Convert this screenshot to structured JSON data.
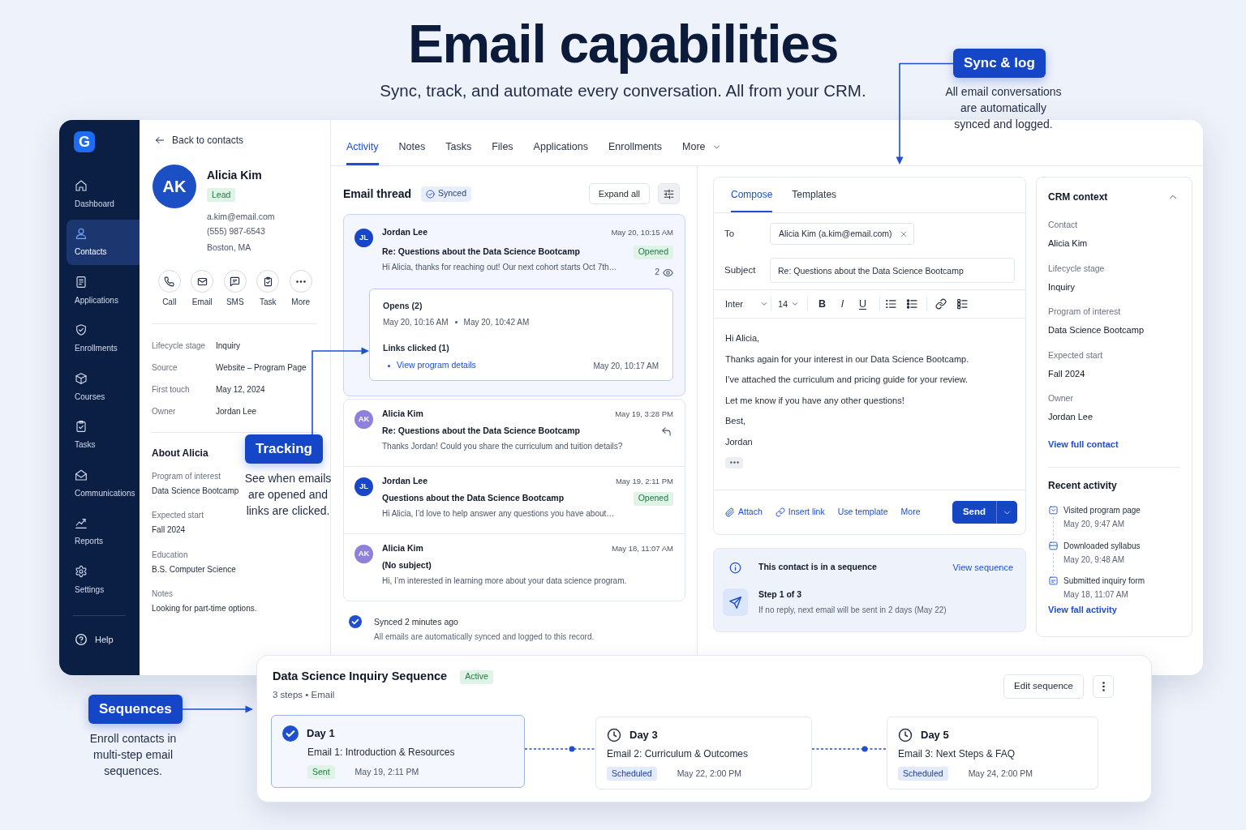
{
  "hero": {
    "title": "Email capabilities",
    "subtitle": "Sync, track, and automate every conversation. All from your CRM."
  },
  "sidebar": {
    "logo": "G",
    "items": [
      {
        "label": "Dashboard",
        "selected": false
      },
      {
        "label": "Contacts",
        "selected": true
      },
      {
        "label": "Applications",
        "selected": false
      },
      {
        "label": "Enrollments",
        "selected": false
      },
      {
        "label": "Courses",
        "selected": false
      },
      {
        "label": "Tasks",
        "selected": false
      },
      {
        "label": "Communications",
        "selected": false
      },
      {
        "label": "Reports",
        "selected": false
      },
      {
        "label": "Settings",
        "selected": false
      }
    ],
    "help": "Help"
  },
  "contact": {
    "back": "Back to contacts",
    "initials": "AK",
    "name": "Alicia Kim",
    "badge": "Lead",
    "email": "a.kim@email.com",
    "phone": "(555) 987-6543",
    "location": "Boston, MA",
    "actions": [
      "Call",
      "Email",
      "SMS",
      "Task",
      "More"
    ],
    "fields": [
      {
        "label": "Lifecycle stage",
        "value": "Inquiry"
      },
      {
        "label": "Source",
        "value": "Website – Program Page"
      },
      {
        "label": "First touch",
        "value": "May 12, 2024"
      },
      {
        "label": "Owner",
        "value": "Jordan Lee"
      }
    ],
    "about_title": "About Alicia",
    "about": [
      {
        "label": "Program of interest",
        "value": "Data Science Bootcamp"
      },
      {
        "label": "Expected start",
        "value": "Fall 2024"
      },
      {
        "label": "Education",
        "value": "B.S. Computer Science"
      },
      {
        "label": "Notes",
        "value": "Looking for part-time options."
      }
    ]
  },
  "tabs": [
    {
      "label": "Activity",
      "selected": true,
      "kind": "tab"
    },
    {
      "label": "Notes",
      "selected": false,
      "kind": "tab"
    },
    {
      "label": "Tasks",
      "selected": false,
      "kind": "tab"
    },
    {
      "label": "Files",
      "selected": false,
      "kind": "tab"
    },
    {
      "label": "Applications",
      "selected": false,
      "kind": "tab"
    },
    {
      "label": "Enrollments",
      "selected": false,
      "kind": "tab"
    },
    {
      "label": "More",
      "selected": false,
      "kind": "menu"
    }
  ],
  "thread": {
    "title": "Email thread",
    "status": "Synced",
    "expand": "Expand all",
    "messages": [
      {
        "initials": "JL",
        "sender": "Jordan Lee",
        "date": "May 20, 10:15 AM",
        "subject": "Re: Questions about the Data Science Bootcamp",
        "preview": "Hi Alicia, thanks for reaching out! Our next cohort starts Oct 7th…",
        "color": "#1747c8",
        "badge": "Opened",
        "opens": "2",
        "replied": false,
        "expanded": true,
        "tracking": {
          "opens_title": "Opens (2)",
          "opens": [
            "May 20, 10:16 AM",
            "May 20, 10:42 AM"
          ],
          "links_title": "Links clicked (1)",
          "links": [
            {
              "label": "View program details",
              "time": "May 20, 10:17 AM"
            }
          ]
        }
      },
      {
        "initials": "AK",
        "sender": "Alicia Kim",
        "date": "May 19, 3:28 PM",
        "subject": "Re: Questions about the Data Science Bootcamp",
        "preview": "Thanks Jordan! Could you share the curriculum and tuition details?",
        "color": "#8f80dc",
        "replied": true,
        "expanded": false
      },
      {
        "initials": "JL",
        "sender": "Jordan Lee",
        "date": "May 19, 2:11 PM",
        "subject": "Questions about the Data Science Bootcamp",
        "preview": "Hi Alicia, I’d love to help answer any questions you have about…",
        "color": "#1747c8",
        "badge": "Opened",
        "replied": false,
        "expanded": false
      },
      {
        "initials": "AK",
        "sender": "Alicia Kim",
        "date": "May 18, 11:07 AM",
        "subject": "(No subject)",
        "preview": "Hi, I’m interested in learning more about your data science program.",
        "color": "#8f80dc",
        "replied": false,
        "expanded": false
      }
    ],
    "footer": {
      "status": "Synced 2 minutes ago",
      "note": "All emails are automatically synced and logged to this record."
    }
  },
  "compose": {
    "tabs": [
      {
        "label": "Compose",
        "selected": true
      },
      {
        "label": "Templates",
        "selected": false
      }
    ],
    "to_label": "To",
    "recipient": "Alicia Kim (a.kim@email.com)",
    "subject_label": "Subject",
    "subject": "Re: Questions about the Data Science Bootcamp",
    "font": "Inter",
    "size": "14",
    "format": [
      "B",
      "I",
      "U"
    ],
    "body": [
      "Hi Alicia,",
      "Thanks again for your interest in our Data Science Bootcamp.",
      "I’ve attached the curriculum and pricing guide for your review.",
      "Let me know if you have any other questions!",
      "Best,",
      "Jordan"
    ],
    "actions": [
      "Attach",
      "Insert link",
      "Use template",
      "More"
    ],
    "send": "Send"
  },
  "sequence_notice": {
    "title": "This contact is in a sequence",
    "link": "View sequence",
    "step": "Step 1 of 3",
    "note": "If no reply, next email will be sent in 2 days (May 22)"
  },
  "crm": {
    "title": "CRM context",
    "expanded": true,
    "fields": [
      {
        "label": "Contact",
        "value": "Alicia Kim"
      },
      {
        "label": "Lifecycle stage",
        "value": "Inquiry"
      },
      {
        "label": "Program of interest",
        "value": "Data Science Bootcamp"
      },
      {
        "label": "Expected start",
        "value": "Fall 2024"
      },
      {
        "label": "Owner",
        "value": "Jordan Lee"
      }
    ],
    "link": "View full contact",
    "activity_title": "Recent activity",
    "activity": [
      {
        "label": "Visited program page",
        "time": "May 20, 9:47 AM"
      },
      {
        "label": "Downloaded syllabus",
        "time": "May 20, 9:48 AM"
      },
      {
        "label": "Submitted inquiry form",
        "time": "May 18, 11:07 AM"
      }
    ],
    "activity_link": "View fall activity"
  },
  "sequence": {
    "title": "Data Science Inquiry Sequence",
    "status": "Active",
    "meta": "3 steps • Email",
    "edit": "Edit sequence",
    "steps": [
      {
        "kind": "sent",
        "day": "Day 1",
        "email": "Email 1: Introduction & Resources",
        "status": "Sent",
        "date": "May 19, 2:11 PM"
      },
      {
        "kind": "scheduled",
        "day": "Day 3",
        "email": "Email 2: Curriculum & Outcomes",
        "status": "Scheduled",
        "date": "May 22, 2:00 PM"
      },
      {
        "kind": "scheduled",
        "day": "Day 5",
        "email": "Email 3: Next Steps & FAQ",
        "status": "Scheduled",
        "date": "May 24, 2:00 PM"
      }
    ]
  },
  "callouts": [
    {
      "kind": "sync",
      "label": "Sync & log",
      "lines": [
        "All email conversations",
        "are automatically",
        "synced and logged."
      ]
    },
    {
      "kind": "tracking",
      "label": "Tracking",
      "lines": [
        "See when emails",
        "are opened and",
        "links are clicked."
      ]
    },
    {
      "kind": "sequences",
      "label": "Sequences",
      "lines": [
        "Enroll contacts in",
        "multi-step email",
        "sequences."
      ]
    }
  ]
}
